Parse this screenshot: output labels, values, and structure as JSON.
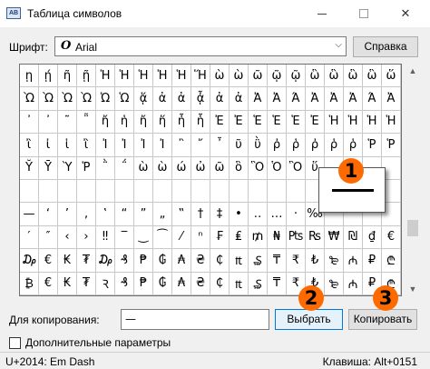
{
  "window": {
    "title": "Таблица символов",
    "icon_text": "AB"
  },
  "controls": {
    "font_label": "Шрифт:",
    "font_glyph": "O",
    "font_value": "Arial",
    "help_button": "Справка",
    "copy_label": "Для копирования:",
    "copy_value": "—",
    "select_button": "Выбрать",
    "copy_button": "Копировать",
    "advanced_label": "Дополнительные параметры",
    "advanced_checked": false
  },
  "status": {
    "left": "U+2014: Em Dash",
    "right": "Клавиша: Alt+0151"
  },
  "annotations": [
    "1",
    "2",
    "3"
  ],
  "zoom": {
    "char": "—"
  },
  "grid": [
    [
      "ῃ",
      "ῄ",
      "ῆ",
      "ῇ",
      "Ἡ",
      "Ἡ",
      "Ἡ",
      "Ἡ",
      "Ἡ",
      "Ἥ",
      "ὼ",
      "ὼ",
      "ῶ",
      "ῷ",
      "ῷ",
      "ὣ",
      "ὣ",
      "ὣ",
      "ὣ",
      "ὥ"
    ],
    [
      "Ὼ",
      "Ὼ",
      "Ὼ",
      "Ὼ",
      "Ὠ",
      "Ὡ",
      "ᾅ",
      "ἀ",
      "ἀ",
      "ᾆ",
      "ἀ",
      "ἀ",
      "Ἀ",
      "Ἀ",
      "Ά",
      "Ἀ",
      "Ἀ",
      "Ἀ",
      "Ά",
      "Ἀ"
    ],
    [
      "᾿",
      "᾽",
      "῀",
      "῁",
      "ἤ",
      "ἡ",
      "ἤ",
      "ἥ",
      "ἦ",
      "ἧ",
      "Ἐ",
      "Ἐ",
      "Ἑ",
      "Ἑ",
      "Ἑ",
      "Ἐ",
      "Ἡ",
      "Ἡ",
      "Ἡ",
      "Ἡ"
    ],
    [
      "ἲ",
      "ἰ",
      "ἱ",
      "ἲ",
      "Ἰ",
      "Ἰ",
      "Ἰ",
      "Ἰ",
      "῍",
      "῎",
      "῏",
      "ῦ",
      "ῢ",
      "ῤ",
      "ῥ",
      "ῤ",
      "ῥ",
      "ῥ",
      "Ῥ",
      "Ῥ"
    ],
    [
      "Ῠ",
      "Ῡ",
      "Ὺ",
      "Ῥ",
      "῭",
      "΅",
      "ὼ",
      "ὼ",
      "ώ",
      "ὠ",
      "ῶ",
      "ὃ",
      "Ὃ",
      "Ὁ",
      "Ὃ",
      "ὕ",
      "",
      "",
      "",
      ""
    ],
    [
      "",
      "",
      "",
      "",
      "",
      "",
      "",
      "",
      "",
      "",
      "",
      "",
      "",
      "",
      "",
      "",
      "",
      "",
      "",
      ""
    ],
    [
      "—",
      "‘",
      "’",
      "‚",
      "‛",
      "“",
      "”",
      "„",
      "‟",
      "†",
      "‡",
      "•",
      "‥",
      "…",
      "‧",
      "‰",
      "",
      "",
      "",
      ""
    ],
    [
      "′",
      "″",
      "‹",
      "›",
      "‼",
      "‾",
      "‿",
      "⁀",
      "⁄",
      "ⁿ",
      "₣",
      "₤",
      "₥",
      "₦",
      "₧",
      "₨",
      "₩",
      "₪",
      "₫",
      "€"
    ],
    [
      "₯",
      "€",
      "₭",
      "₮",
      "₯",
      "₰",
      "₱",
      "₲",
      "₳",
      "₴",
      "₵",
      "₶",
      "₷",
      "₸",
      "₹",
      "₺",
      "₻",
      "₼",
      "₽",
      "₾"
    ],
    [
      "₿",
      "€",
      "₭",
      "₮",
      "Ꝛ",
      "₰",
      "₱",
      "₲",
      "₳",
      "₴",
      "₵",
      "₶",
      "₷",
      "₸",
      "₹",
      "₺",
      "₻",
      "₼",
      "₽",
      "₾"
    ]
  ]
}
